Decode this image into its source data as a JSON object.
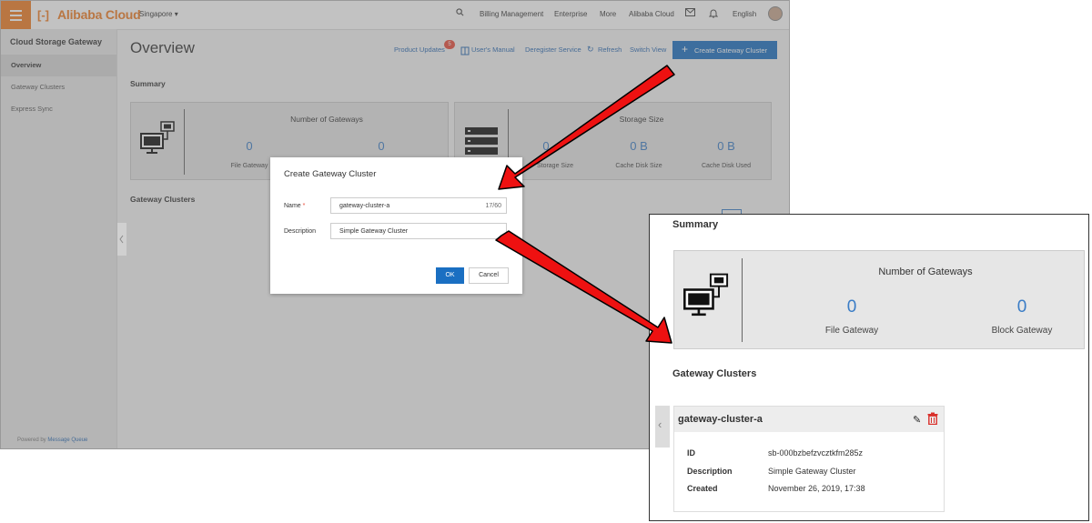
{
  "header": {
    "brand": "Alibaba Cloud",
    "region": "Singapore ▾",
    "nav": [
      "Billing Management",
      "Enterprise",
      "More",
      "Alibaba Cloud"
    ],
    "language": "English"
  },
  "sidebar": {
    "title": "Cloud Storage Gateway",
    "items": [
      {
        "label": "Overview",
        "active": true
      },
      {
        "label": "Gateway Clusters",
        "active": false
      },
      {
        "label": "Express Sync",
        "active": false
      }
    ],
    "powered_prefix": "Powered by ",
    "powered_link": "Message Queue"
  },
  "page": {
    "title": "Overview",
    "actions": {
      "product_updates": "Product Updates",
      "updates_count": "5",
      "users_manual": "User's Manual",
      "deregister": "Deregister Service",
      "refresh": "Refresh",
      "switch_view": "Switch View",
      "create": "Create Gateway Cluster"
    },
    "summary_heading": "Summary",
    "gateways_card": {
      "title": "Number of Gateways",
      "file_count": "0",
      "file_label": "File Gateway",
      "block_count": "0"
    },
    "storage_card": {
      "title": "Storage Size",
      "storage_value": "0",
      "storage_label": "Storage Size",
      "cache_disk_value": "0 B",
      "cache_disk_label": "Cache Disk Size",
      "cache_used_value": "0 B",
      "cache_used_label": "Cache Disk Used"
    },
    "clusters_heading": "Gateway Clusters"
  },
  "modal": {
    "title": "Create Gateway Cluster",
    "name_label": "Name",
    "name_required": "*",
    "name_value": "gateway-cluster-a",
    "name_counter": "17/60",
    "description_label": "Description",
    "description_value": "Simple Gateway Cluster",
    "ok": "OK",
    "cancel": "Cancel"
  },
  "zoom": {
    "summary_heading": "Summary",
    "gateways_title": "Number of Gateways",
    "file_count": "0",
    "file_label": "File Gateway",
    "block_count": "0",
    "block_label": "Block Gateway",
    "clusters_heading": "Gateway Clusters",
    "cluster": {
      "name": "gateway-cluster-a",
      "id_label": "ID",
      "id_value": "sb-000bzbefzvcztkfm285z",
      "description_label": "Description",
      "description_value": "Simple Gateway Cluster",
      "created_label": "Created",
      "created_value": "November 26, 2019, 17:38"
    }
  },
  "colors": {
    "brand_orange": "#f07c24",
    "primary_blue": "#1a6fc2",
    "link_blue": "#2a6ab3",
    "badge_red": "#e84a3a",
    "arrow_red": "#ee1111"
  },
  "icons": [
    "menu-icon",
    "search-icon",
    "mail-icon",
    "bell-icon",
    "book-icon",
    "refresh-icon",
    "plus-icon",
    "computer-gateway-icon",
    "server-stack-icon",
    "edit-icon",
    "trash-icon",
    "chevron-left-icon"
  ]
}
